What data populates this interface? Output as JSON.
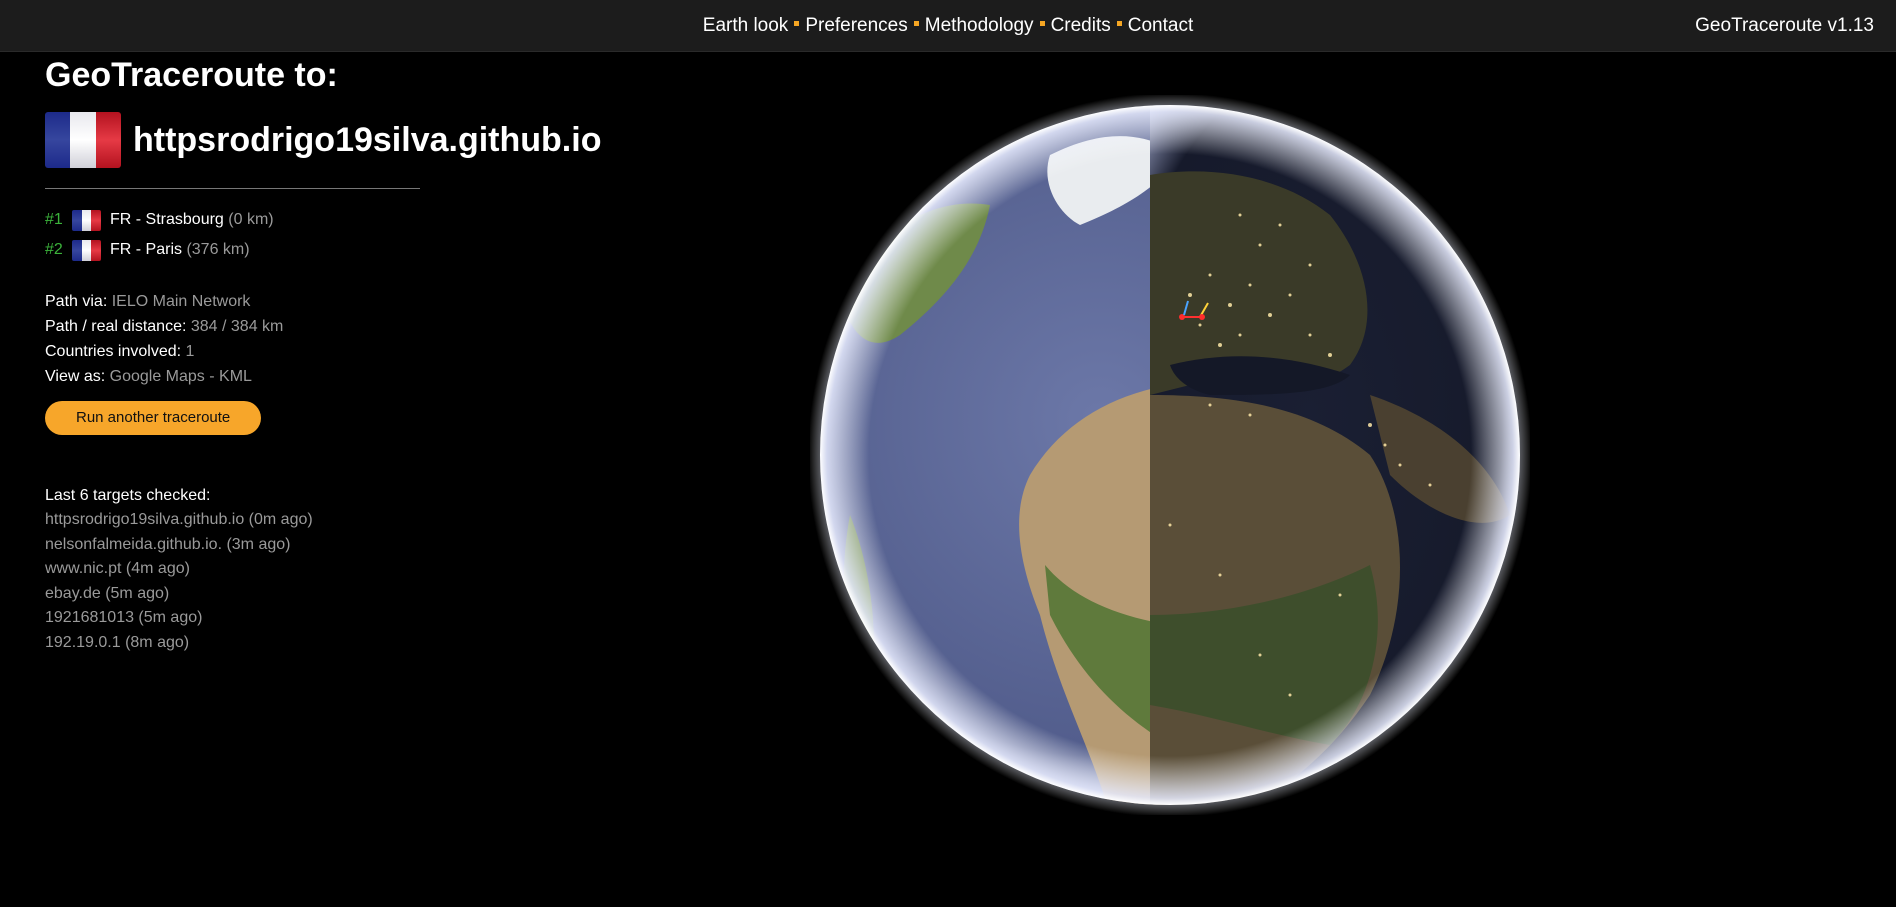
{
  "nav": {
    "items": [
      "Earth look",
      "Preferences",
      "Methodology",
      "Credits",
      "Contact"
    ],
    "version": "GeoTraceroute v1.13",
    "separator_color": "#f5a623"
  },
  "main": {
    "heading": "GeoTraceroute to:",
    "target": "httpsrodrigo19silva.github.io",
    "target_flag": "france-flag-icon"
  },
  "hops": [
    {
      "num": "#1",
      "location": "FR - Strasbourg",
      "distance": "(0 km)"
    },
    {
      "num": "#2",
      "location": "FR - Paris",
      "distance": "(376 km)"
    }
  ],
  "info": {
    "path_via_label": "Path via:",
    "path_via_value": "IELO Main Network",
    "distance_label": "Path / real distance:",
    "distance_value": "384 / 384 km",
    "countries_label": "Countries involved:",
    "countries_value": "1",
    "view_as_label": "View as:",
    "view_google": "Google Maps",
    "view_sep": " - ",
    "view_kml": "KML"
  },
  "button": {
    "label": "Run another traceroute",
    "color": "#f7a62a"
  },
  "recent": {
    "title": "Last 6 targets checked:",
    "items": [
      "httpsrodrigo19silva.github.io (0m ago)",
      "nelsonfalmeida.github.io. (3m ago)",
      "www.nic.pt (4m ago)",
      "ebay.de (5m ago)",
      "1921681013 (5m ago)",
      "192.19.0.1 (8m ago)"
    ]
  },
  "colors": {
    "hop_number": "#3bb33b",
    "secondary_text": "#9a9a9a",
    "background": "#000000",
    "topbar": "#1c1c1c"
  }
}
